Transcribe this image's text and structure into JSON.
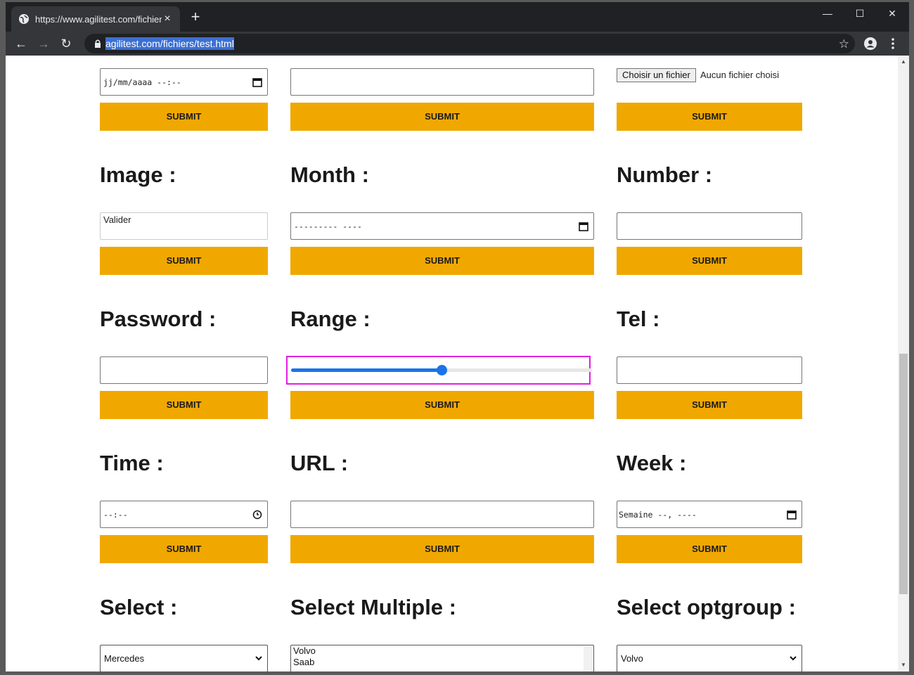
{
  "browser": {
    "tab_title": "https://www.agilitest.com/fichiers/test.html",
    "url": "agilitest.com/fichiers/test.html",
    "new_tab": "+",
    "close_tab": "×",
    "minimize": "—",
    "maximize": "☐",
    "close_window": "✕"
  },
  "top_row": {
    "date_placeholder": "jj/mm/aaaa --:--",
    "file_button": "Choisir un fichier",
    "file_status": "Aucun fichier choisi",
    "submit": "SUBMIT"
  },
  "sections": {
    "image": {
      "label": "Image :",
      "alt": "Valider"
    },
    "month": {
      "label": "Month :",
      "placeholder": "--------- ----"
    },
    "number": {
      "label": "Number :"
    },
    "password": {
      "label": "Password :"
    },
    "range": {
      "label": "Range :",
      "value_fraction": 0.5
    },
    "tel": {
      "label": "Tel :"
    },
    "time": {
      "label": "Time :",
      "placeholder": "--:--"
    },
    "url": {
      "label": "URL :"
    },
    "week": {
      "label": "Week :",
      "placeholder": "Semaine --, ----"
    },
    "select": {
      "label": "Select :",
      "value": "Mercedes"
    },
    "select_multiple": {
      "label": "Select Multiple :",
      "options": [
        "Volvo",
        "Saab"
      ]
    },
    "select_optgroup": {
      "label": "Select optgroup :",
      "value": "Volvo"
    }
  },
  "submit_label": "SUBMIT",
  "colors": {
    "submit_bg": "#f0a800",
    "highlight": "#e020e0",
    "range_accent": "#1a73e8"
  }
}
